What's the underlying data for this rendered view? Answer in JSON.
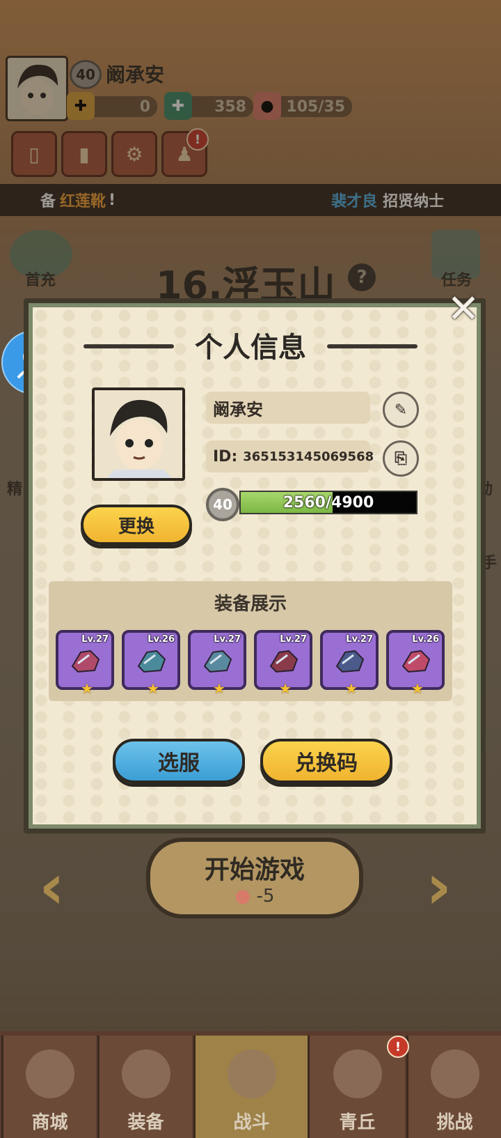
{
  "player": {
    "level": "40",
    "name": "阚承安"
  },
  "resources": [
    {
      "icon": "scroll-icon",
      "value": "0"
    },
    {
      "icon": "jade-icon",
      "value": "358"
    },
    {
      "icon": "peach-icon",
      "value": "105/35"
    }
  ],
  "ticker": {
    "left_prefix": "备",
    "left_item": "红莲靴",
    "left_suffix": "!",
    "right_name": "裴才良",
    "right_text": "招贤纳士"
  },
  "side": {
    "first_charge": "首充",
    "tasks": "任务",
    "left_cut": "精",
    "right_cut": "动",
    "right_cut2": "手"
  },
  "stage": {
    "title": "16.浮玉山",
    "help": "?"
  },
  "modal": {
    "title": "个人信息",
    "name": "阚承安",
    "id_label": "ID:",
    "id_value": "365153145069568",
    "level": "40",
    "xp_text": "2560/4900",
    "xp_fraction": 0.522,
    "change_button": "更换",
    "equip_title": "装备展示",
    "equipment": [
      {
        "level": "Lv.27",
        "icon": "saddle-icon",
        "color": "#b04a6a"
      },
      {
        "level": "Lv.26",
        "icon": "shoulder-armor-icon",
        "color": "#4a8a9a"
      },
      {
        "level": "Lv.27",
        "icon": "bracer-icon",
        "color": "#5a8aa0"
      },
      {
        "level": "Lv.27",
        "icon": "belt-icon",
        "color": "#8a3b4a"
      },
      {
        "level": "Lv.27",
        "icon": "boots-icon",
        "color": "#4a5a8a"
      },
      {
        "level": "Lv.26",
        "icon": "amulet-icon",
        "color": "#c04a6a"
      }
    ],
    "server_button": "选服",
    "code_button": "兑换码"
  },
  "start": {
    "label": "开始游戏",
    "cost": "-5"
  },
  "nav": [
    {
      "label": "商城",
      "icon": "shop-icon"
    },
    {
      "label": "装备",
      "icon": "helmet-icon"
    },
    {
      "label": "战斗",
      "icon": "crossed-swords-icon"
    },
    {
      "label": "青丘",
      "icon": "mountain-icon"
    },
    {
      "label": "挑战",
      "icon": "orb-icon"
    }
  ]
}
